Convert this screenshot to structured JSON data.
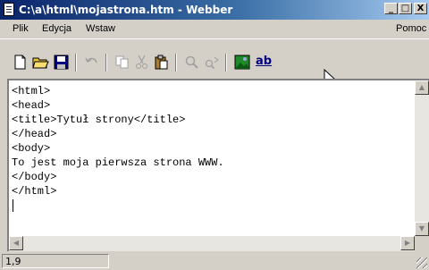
{
  "window": {
    "title": "C:\\a\\html\\mojastrona.htm - Webber"
  },
  "title_buttons": {
    "minimize": "_",
    "maximize": "□",
    "close": "X"
  },
  "menu": {
    "items": [
      "Plik",
      "Edycja",
      "Wstaw"
    ],
    "help": "Pomoc"
  },
  "toolbar": {
    "buttons": [
      "new-file-icon",
      "open-folder-icon",
      "save-icon",
      "undo-icon",
      "copy-icon",
      "cut-icon",
      "paste-icon",
      "find-icon",
      "replace-icon",
      "preview-image-icon",
      "underline-ab-icon"
    ],
    "ab_label": "ab"
  },
  "editor": {
    "content": "<html>\n<head>\n<title>Tytuł strony</title>\n</head>\n<body>\nTo jest moja pierwsza strona WWW.\n</body>\n</html>"
  },
  "status": {
    "position": "1,9"
  }
}
